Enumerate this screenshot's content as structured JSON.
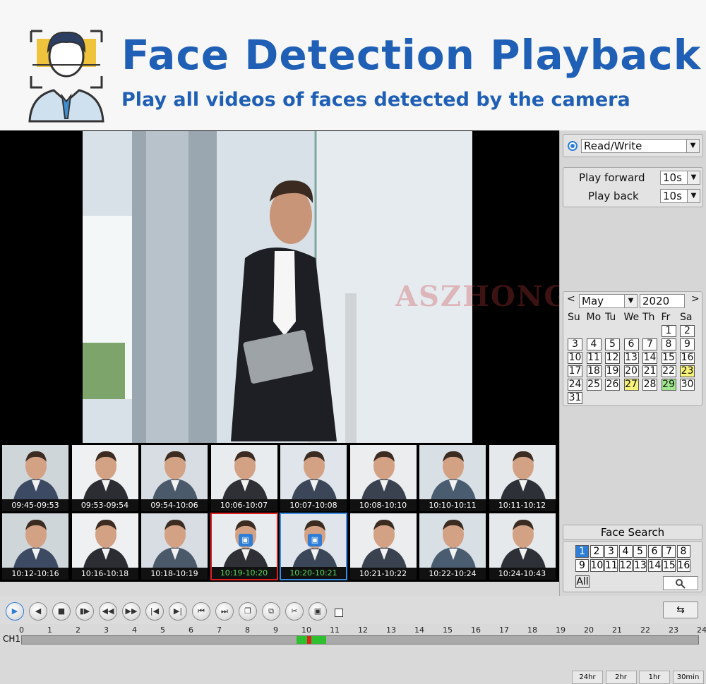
{
  "banner": {
    "title": "Face Detection Playback",
    "subtitle": "Play all videos of faces detected by the camera",
    "title_color": "#1f5fb5"
  },
  "watermark": "ASZHONGA",
  "side": {
    "mode": "Read/Write",
    "play_forward_label": "Play forward",
    "play_forward_value": "10s",
    "play_back_label": "Play back",
    "play_back_value": "10s"
  },
  "calendar": {
    "prev": "<",
    "next": ">",
    "month": "May",
    "year": "2020",
    "weekdays": [
      "Su",
      "Mo",
      "Tu",
      "We",
      "Th",
      "Fr",
      "Sa"
    ],
    "days": [
      "1",
      "2",
      "3",
      "4",
      "5",
      "6",
      "7",
      "8",
      "9",
      "10",
      "11",
      "12",
      "13",
      "14",
      "15",
      "16",
      "17",
      "18",
      "19",
      "20",
      "21",
      "22",
      "23",
      "24",
      "25",
      "26",
      "27",
      "28",
      "29",
      "30",
      "31"
    ],
    "highlight_yellow": [
      "23",
      "27"
    ],
    "highlight_green": [
      "29"
    ]
  },
  "face_search": {
    "title": "Face Search",
    "channels": [
      "1",
      "2",
      "3",
      "4",
      "5",
      "6",
      "7",
      "8",
      "9",
      "10",
      "11",
      "12",
      "13",
      "14",
      "15",
      "16"
    ],
    "selected_channel": "1",
    "all_label": "All",
    "search_icon": "search-icon"
  },
  "thumbnails": [
    "09:45-09:53",
    "09:53-09:54",
    "09:54-10:06",
    "10:06-10:07",
    "10:07-10:08",
    "10:08-10:10",
    "10:10-10:11",
    "10:11-10:12",
    "10:12-10:16",
    "10:16-10:18",
    "10:18-10:19",
    "10:19-10:20",
    "10:20-10:21",
    "10:21-10:22",
    "10:22-10:24",
    "10:24-10:43"
  ],
  "controls": {
    "icons": [
      "play-icon",
      "rewind-icon",
      "stop-icon",
      "step-icon",
      "fast-back-icon",
      "fast-forward-icon",
      "prev-frame-icon",
      "next-frame-icon",
      "prev-file-icon",
      "next-file-icon",
      "fullscreen-icon",
      "copy-icon",
      "cut-icon",
      "save-icon"
    ],
    "sync_icon": "sync-icon"
  },
  "timeline": {
    "channel": "CH1",
    "hours": [
      "0",
      "1",
      "2",
      "3",
      "4",
      "5",
      "6",
      "7",
      "8",
      "9",
      "10",
      "11",
      "12",
      "13",
      "14",
      "15",
      "16",
      "17",
      "18",
      "19",
      "20",
      "21",
      "22",
      "23",
      "24"
    ],
    "zoom": [
      "24hr",
      "2hr",
      "1hr",
      "30min"
    ],
    "record_color_normal": "#2ec02e",
    "record_color_alarm": "#e02020"
  }
}
